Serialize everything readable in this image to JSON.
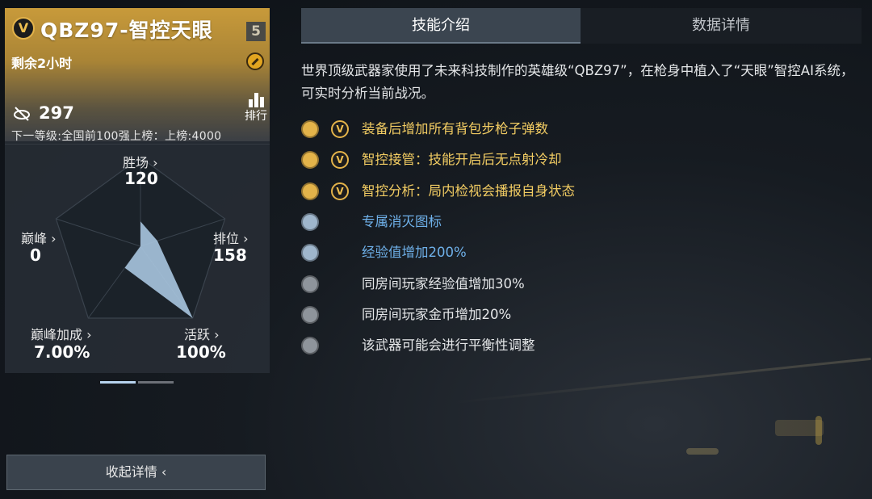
{
  "weapon": {
    "title": "QBZ97-智控天眼",
    "tier": "5",
    "remaining": "剩余2小时",
    "score": "297",
    "rank_label": "排行",
    "next_level": "下一等级:全国前100强上榜：上榜:4000"
  },
  "stats": [
    {
      "label": "胜场 ›",
      "value": "120"
    },
    {
      "label": "排位 ›",
      "value": "158"
    },
    {
      "label": "活跃 ›",
      "value": "100%"
    },
    {
      "label": "巅峰加成 ›",
      "value": "7.00%"
    },
    {
      "label": "巅峰 ›",
      "value": "0"
    }
  ],
  "radar_levels": {
    "胜场": 0.28,
    "排位": 0.2,
    "活跃": 1.0,
    "巅峰加成": 0.3,
    "巅峰": 0.0
  },
  "pagination": {
    "pages": 2,
    "active": 0
  },
  "collapse_label": "收起详情 ‹",
  "tabs": [
    {
      "label": "技能介绍",
      "active": true
    },
    {
      "label": "数据详情",
      "active": false
    }
  ],
  "description": "世界顶级武器家使用了未来科技制作的英雄级“QBZ97”，在枪身中植入了“天眼”智控AI系统，可实时分析当前战况。",
  "skills": [
    {
      "icon": "ammo-icon",
      "text": "装备后增加所有背包步枪子弹数",
      "color": "#f3cd63",
      "v_badge": true
    },
    {
      "icon": "info-icon",
      "text": "智控接管：技能开启后无点射冷却",
      "color": "#f3cd63",
      "v_badge": true
    },
    {
      "icon": "analysis-icon",
      "text": "智控分析：局内检视会播报自身状态",
      "color": "#f3cd63",
      "v_badge": true
    },
    {
      "icon": "kill-icon",
      "text": "专属消灭图标",
      "color": "#6fb1ea",
      "v_badge": false
    },
    {
      "icon": "exp-icon",
      "text": "经验值增加200%",
      "color": "#6fb1ea",
      "v_badge": false
    },
    {
      "icon": "team-exp-icon",
      "text": "同房间玩家经验值增加30%",
      "color": "#e4e6e8",
      "v_badge": false
    },
    {
      "icon": "coin-icon",
      "text": "同房间玩家金币增加20%",
      "color": "#e4e6e8",
      "v_badge": false
    },
    {
      "icon": "balance-icon",
      "text": "该武器可能会进行平衡性调整",
      "color": "#e4e6e8",
      "v_badge": false
    }
  ]
}
